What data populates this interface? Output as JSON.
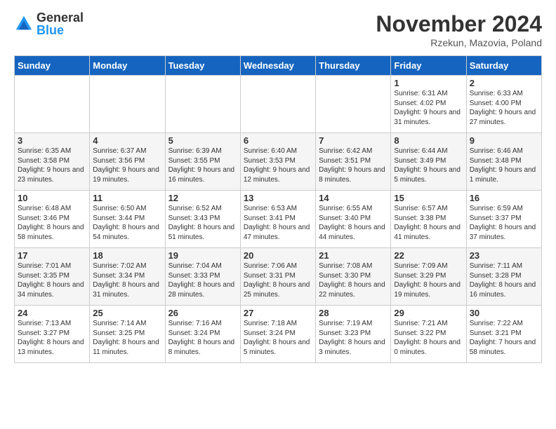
{
  "logo": {
    "general": "General",
    "blue": "Blue"
  },
  "header": {
    "month": "November 2024",
    "location": "Rzekun, Mazovia, Poland"
  },
  "days_of_week": [
    "Sunday",
    "Monday",
    "Tuesday",
    "Wednesday",
    "Thursday",
    "Friday",
    "Saturday"
  ],
  "rows": [
    [
      {
        "day": "",
        "info": ""
      },
      {
        "day": "",
        "info": ""
      },
      {
        "day": "",
        "info": ""
      },
      {
        "day": "",
        "info": ""
      },
      {
        "day": "",
        "info": ""
      },
      {
        "day": "1",
        "info": "Sunrise: 6:31 AM\nSunset: 4:02 PM\nDaylight: 9 hours and 31 minutes."
      },
      {
        "day": "2",
        "info": "Sunrise: 6:33 AM\nSunset: 4:00 PM\nDaylight: 9 hours and 27 minutes."
      }
    ],
    [
      {
        "day": "3",
        "info": "Sunrise: 6:35 AM\nSunset: 3:58 PM\nDaylight: 9 hours and 23 minutes."
      },
      {
        "day": "4",
        "info": "Sunrise: 6:37 AM\nSunset: 3:56 PM\nDaylight: 9 hours and 19 minutes."
      },
      {
        "day": "5",
        "info": "Sunrise: 6:39 AM\nSunset: 3:55 PM\nDaylight: 9 hours and 16 minutes."
      },
      {
        "day": "6",
        "info": "Sunrise: 6:40 AM\nSunset: 3:53 PM\nDaylight: 9 hours and 12 minutes."
      },
      {
        "day": "7",
        "info": "Sunrise: 6:42 AM\nSunset: 3:51 PM\nDaylight: 9 hours and 8 minutes."
      },
      {
        "day": "8",
        "info": "Sunrise: 6:44 AM\nSunset: 3:49 PM\nDaylight: 9 hours and 5 minutes."
      },
      {
        "day": "9",
        "info": "Sunrise: 6:46 AM\nSunset: 3:48 PM\nDaylight: 9 hours and 1 minute."
      }
    ],
    [
      {
        "day": "10",
        "info": "Sunrise: 6:48 AM\nSunset: 3:46 PM\nDaylight: 8 hours and 58 minutes."
      },
      {
        "day": "11",
        "info": "Sunrise: 6:50 AM\nSunset: 3:44 PM\nDaylight: 8 hours and 54 minutes."
      },
      {
        "day": "12",
        "info": "Sunrise: 6:52 AM\nSunset: 3:43 PM\nDaylight: 8 hours and 51 minutes."
      },
      {
        "day": "13",
        "info": "Sunrise: 6:53 AM\nSunset: 3:41 PM\nDaylight: 8 hours and 47 minutes."
      },
      {
        "day": "14",
        "info": "Sunrise: 6:55 AM\nSunset: 3:40 PM\nDaylight: 8 hours and 44 minutes."
      },
      {
        "day": "15",
        "info": "Sunrise: 6:57 AM\nSunset: 3:38 PM\nDaylight: 8 hours and 41 minutes."
      },
      {
        "day": "16",
        "info": "Sunrise: 6:59 AM\nSunset: 3:37 PM\nDaylight: 8 hours and 37 minutes."
      }
    ],
    [
      {
        "day": "17",
        "info": "Sunrise: 7:01 AM\nSunset: 3:35 PM\nDaylight: 8 hours and 34 minutes."
      },
      {
        "day": "18",
        "info": "Sunrise: 7:02 AM\nSunset: 3:34 PM\nDaylight: 8 hours and 31 minutes."
      },
      {
        "day": "19",
        "info": "Sunrise: 7:04 AM\nSunset: 3:33 PM\nDaylight: 8 hours and 28 minutes."
      },
      {
        "day": "20",
        "info": "Sunrise: 7:06 AM\nSunset: 3:31 PM\nDaylight: 8 hours and 25 minutes."
      },
      {
        "day": "21",
        "info": "Sunrise: 7:08 AM\nSunset: 3:30 PM\nDaylight: 8 hours and 22 minutes."
      },
      {
        "day": "22",
        "info": "Sunrise: 7:09 AM\nSunset: 3:29 PM\nDaylight: 8 hours and 19 minutes."
      },
      {
        "day": "23",
        "info": "Sunrise: 7:11 AM\nSunset: 3:28 PM\nDaylight: 8 hours and 16 minutes."
      }
    ],
    [
      {
        "day": "24",
        "info": "Sunrise: 7:13 AM\nSunset: 3:27 PM\nDaylight: 8 hours and 13 minutes."
      },
      {
        "day": "25",
        "info": "Sunrise: 7:14 AM\nSunset: 3:25 PM\nDaylight: 8 hours and 11 minutes."
      },
      {
        "day": "26",
        "info": "Sunrise: 7:16 AM\nSunset: 3:24 PM\nDaylight: 8 hours and 8 minutes."
      },
      {
        "day": "27",
        "info": "Sunrise: 7:18 AM\nSunset: 3:24 PM\nDaylight: 8 hours and 5 minutes."
      },
      {
        "day": "28",
        "info": "Sunrise: 7:19 AM\nSunset: 3:23 PM\nDaylight: 8 hours and 3 minutes."
      },
      {
        "day": "29",
        "info": "Sunrise: 7:21 AM\nSunset: 3:22 PM\nDaylight: 8 hours and 0 minutes."
      },
      {
        "day": "30",
        "info": "Sunrise: 7:22 AM\nSunset: 3:21 PM\nDaylight: 7 hours and 58 minutes."
      }
    ]
  ]
}
